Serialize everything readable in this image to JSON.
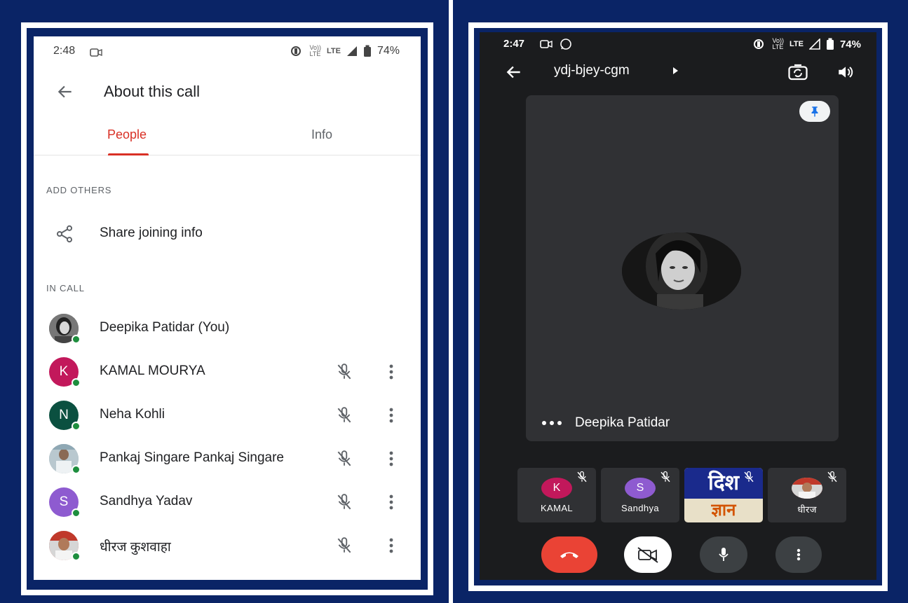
{
  "colors": {
    "frame_navy": "#0a2466",
    "accent_red": "#d93025",
    "online_green": "#1e8e3e",
    "end_call_red": "#ea4335",
    "meet_background": "#1b1c1e",
    "tile_background": "#303134"
  },
  "left_screen": {
    "status": {
      "time": "2:48",
      "net_small_top": "Vo))",
      "net_small_bottom": "LTE",
      "lte": "LTE",
      "battery": "74%"
    },
    "title": "About this call",
    "tabs": [
      {
        "label": "People",
        "active": true
      },
      {
        "label": "Info",
        "active": false
      }
    ],
    "add_others_label": "ADD OTHERS",
    "share_label": "Share joining info",
    "in_call_label": "IN CALL",
    "participants": [
      {
        "name": "Deepika Patidar (You)",
        "initial": "",
        "avatar_color": "#555555",
        "photo": true,
        "muted_icon": false
      },
      {
        "name": "KAMAL MOURYA",
        "initial": "K",
        "avatar_color": "#c2185b",
        "photo": false,
        "muted_icon": true
      },
      {
        "name": "Neha Kohli",
        "initial": "N",
        "avatar_color": "#0b5040",
        "photo": false,
        "muted_icon": true
      },
      {
        "name": "Pankaj Singare Pankaj Singare",
        "initial": "",
        "avatar_color": "#9aa8b0",
        "photo": true,
        "muted_icon": true
      },
      {
        "name": "Sandhya Yadav",
        "initial": "S",
        "avatar_color": "#8e5bd0",
        "photo": false,
        "muted_icon": true
      },
      {
        "name": "धीरज कुशवाहा",
        "initial": "",
        "avatar_color": "#c0392b",
        "photo": true,
        "muted_icon": true
      }
    ]
  },
  "right_screen": {
    "status": {
      "time": "2:47",
      "net_small_top": "Vo))",
      "net_small_bottom": "LTE",
      "lte": "LTE",
      "battery": "74%"
    },
    "meeting_code": "ydj-bjey-cgm",
    "main_tile_name": "Deepika Patidar",
    "mini_tiles": [
      {
        "label": "KAMAL",
        "initial": "K",
        "avatar_color": "#c2185b",
        "type": "initial"
      },
      {
        "label": "Sandhya",
        "initial": "S",
        "avatar_color": "#8e5bd0",
        "type": "initial"
      },
      {
        "label": "",
        "banner_top": "दिश",
        "banner_bottom": "ज्ञान",
        "type": "banner"
      },
      {
        "label": "धीरज",
        "initial": "",
        "avatar_color": "#c0392b",
        "type": "photo"
      }
    ]
  }
}
